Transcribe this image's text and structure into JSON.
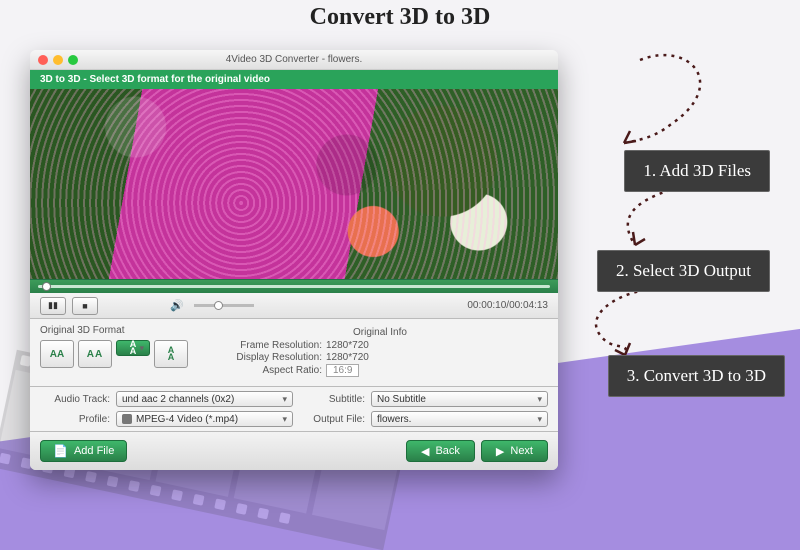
{
  "heading": "Convert 3D to 3D",
  "steps": {
    "s1": "1. Add 3D Files",
    "s2": "2. Select 3D Output",
    "s3": "3. Convert 3D to 3D"
  },
  "window": {
    "title": "4Video 3D Converter - flowers.",
    "subheader": "3D to 3D - Select 3D format for the original video",
    "timecode": "00:00:10/00:04:13",
    "fmt_label": "Original 3D Format",
    "fmt_icons": {
      "a": "AA",
      "b": "AA",
      "c": "A",
      "c2": "A",
      "d": "A",
      "d2": "A"
    },
    "info": {
      "header": "Original Info",
      "frame_k": "Frame Resolution:",
      "frame_v": "1280*720",
      "disp_k": "Display Resolution:",
      "disp_v": "1280*720",
      "aspect_k": "Aspect Ratio:",
      "aspect_v": "16:9"
    },
    "opts": {
      "audio_k": "Audio Track:",
      "audio_v": "und aac 2 channels (0x2)",
      "subtitle_k": "Subtitle:",
      "subtitle_v": "No Subtitle",
      "profile_k": "Profile:",
      "profile_v": "MPEG-4 Video (*.mp4)",
      "outfile_k": "Output File:",
      "outfile_v": "flowers."
    },
    "buttons": {
      "add": "Add File",
      "back": "Back",
      "next": "Next"
    },
    "volume_icon": "🔊",
    "pause_icon": "▮▮",
    "stop_icon": "■"
  }
}
